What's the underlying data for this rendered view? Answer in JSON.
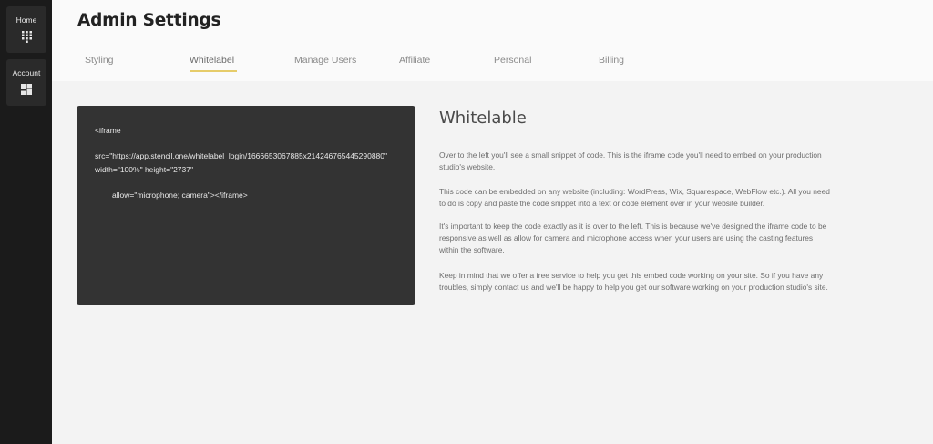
{
  "sidebar": {
    "items": [
      {
        "label": "Home",
        "icon": "dialpad-icon"
      },
      {
        "label": "Account",
        "icon": "dashboard-icon"
      }
    ]
  },
  "header": {
    "title": "Admin Settings",
    "tabs": [
      {
        "label": "Styling",
        "active": false
      },
      {
        "label": "Whitelabel",
        "active": true
      },
      {
        "label": "Manage Users",
        "active": false
      },
      {
        "label": "Affiliate",
        "active": false
      },
      {
        "label": "Personal",
        "active": false
      },
      {
        "label": "Billing",
        "active": false
      }
    ],
    "accent_color": "#e6cc6a"
  },
  "code": {
    "line1": "<iframe",
    "line2": "src=\"https://app.stencil.one/whitelabel_login/1666653067885x214246765445290880\"",
    "line3": "width=\"100%\" height=\"2737\"",
    "line4": "allow=\"microphone; camera\"></iframe>"
  },
  "info": {
    "title": "Whitelable",
    "paragraphs": [
      "Over to the left you'll see a small snippet of code. This is the iframe code you'll need to embed on your production studio's website.",
      "This code can be embedded on any website (including: WordPress, Wix, Squarespace, WebFlow etc.). All you need to do is copy and paste the code snippet into a text or code element over in your website builder.",
      "It's important to keep the code exactly as it is over to the left. This is because we've designed the iframe code to be responsive as well as allow for camera and microphone access when your users are using the casting features within the software.",
      "Keep in mind that we offer a free service to help you get this embed code working on your site. So if you have any troubles, simply contact us and we'll be happy to help you get our software working on your production studio's site."
    ]
  }
}
